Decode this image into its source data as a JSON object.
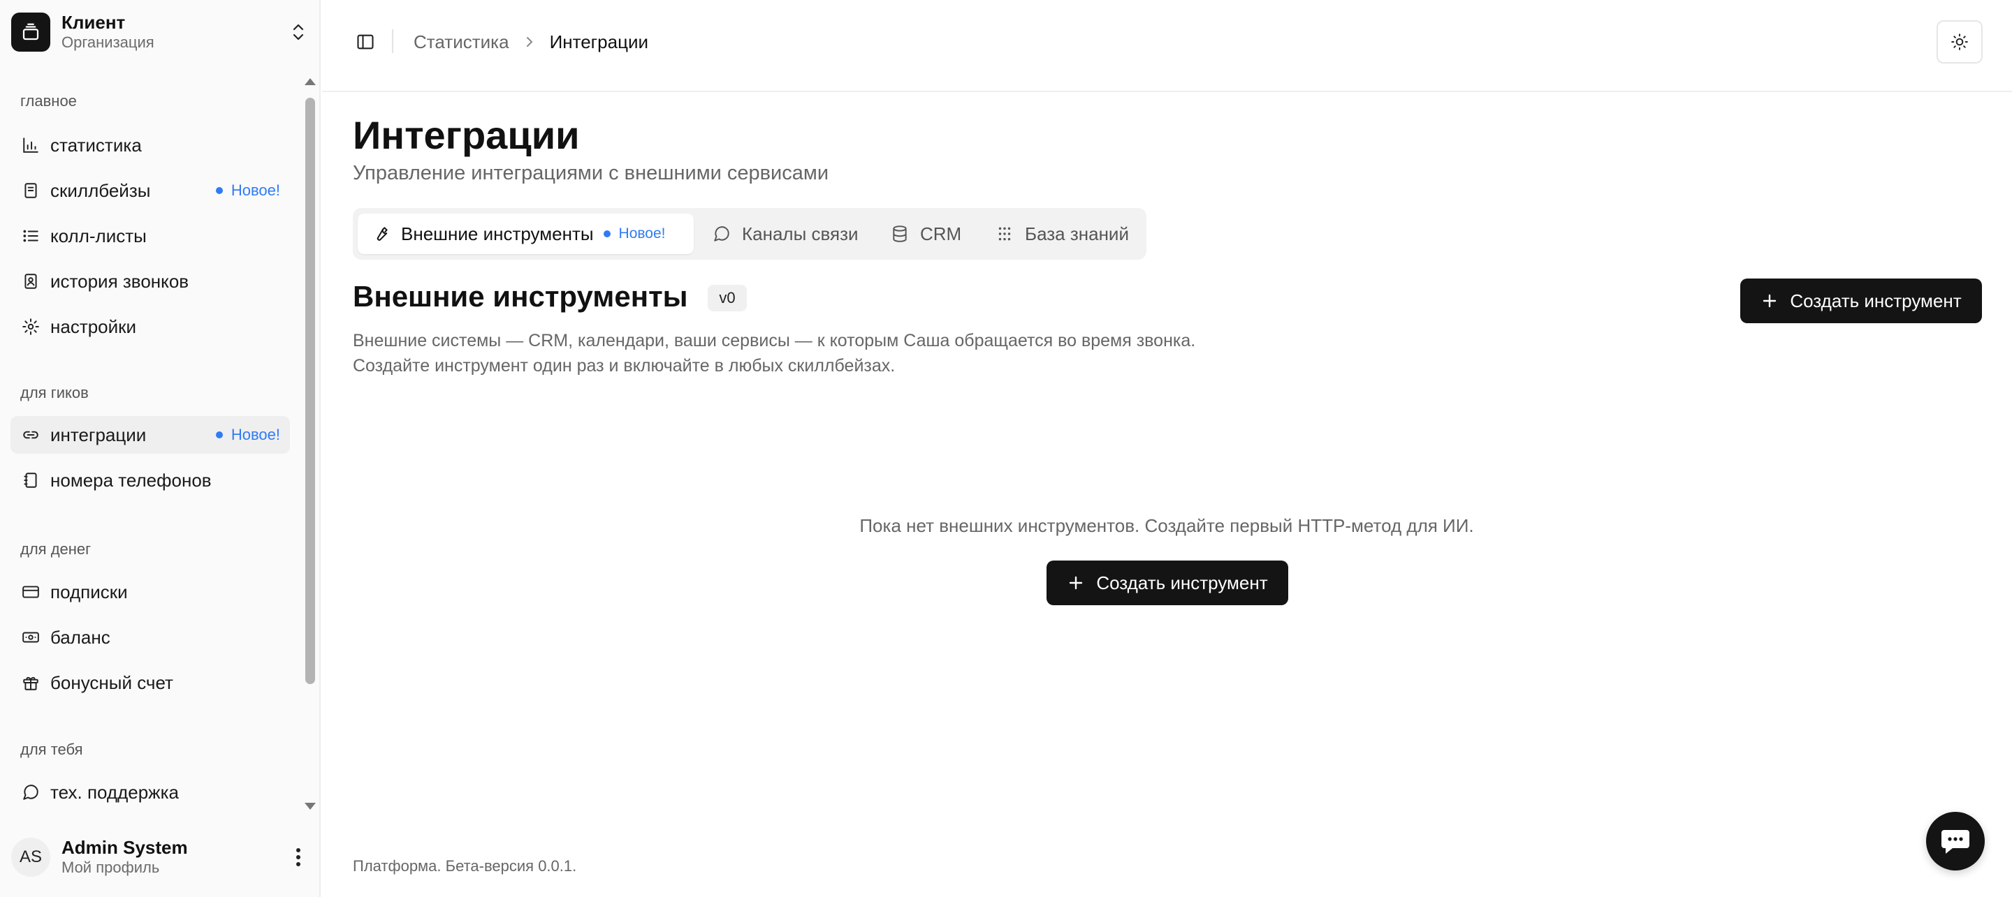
{
  "org": {
    "name": "Клиент",
    "subtitle": "Организация"
  },
  "sidebar": {
    "sections": [
      {
        "label": "главное"
      },
      {
        "label": "для гиков"
      },
      {
        "label": "для денег"
      },
      {
        "label": "для тебя"
      }
    ],
    "items": [
      {
        "label": "статистика",
        "icon": "bar-chart-icon"
      },
      {
        "label": "скиллбейзы",
        "icon": "notebook-icon",
        "badge": "Новое!"
      },
      {
        "label": "колл-листы",
        "icon": "list-icon"
      },
      {
        "label": "история звонков",
        "icon": "contact-book-icon"
      },
      {
        "label": "настройки",
        "icon": "gear-icon"
      },
      {
        "label": "интеграции",
        "icon": "link-icon",
        "badge": "Новое!",
        "active": true
      },
      {
        "label": "номера телефонов",
        "icon": "phone-book-icon"
      },
      {
        "label": "подписки",
        "icon": "credit-card-icon"
      },
      {
        "label": "баланс",
        "icon": "banknote-icon"
      },
      {
        "label": "бонусный счет",
        "icon": "gift-icon"
      },
      {
        "label": "тех. поддержка",
        "icon": "chat-bubble-icon"
      }
    ]
  },
  "user": {
    "initials": "AS",
    "name": "Admin System",
    "subtitle": "Мой профиль"
  },
  "breadcrumb": {
    "parent": "Статистика",
    "current": "Интеграции"
  },
  "page": {
    "title": "Интеграции",
    "subtitle": "Управление интеграциями с внешними сервисами"
  },
  "tabs": [
    {
      "label": "Внешние инструменты",
      "badge": "Новое!",
      "icon": "wrench-icon",
      "active": true
    },
    {
      "label": "Каналы связи",
      "icon": "chat-bubble-icon"
    },
    {
      "label": "CRM",
      "icon": "database-icon"
    },
    {
      "label": "База знаний",
      "icon": "grid-dots-icon"
    }
  ],
  "section": {
    "title": "Внешние инструменты",
    "version": "v0",
    "description_line1": "Внешние системы — CRM, календари, ваши сервисы — к которым Саша обращается во время звонка.",
    "description_line2": "Создайте инструмент один раз и включайте в любых скиллбейзах.",
    "create_button": "Создать инструмент"
  },
  "empty_state": {
    "text": "Пока нет внешних инструментов. Создайте первый HTTP-метод для ИИ.",
    "button": "Создать инструмент"
  },
  "footer": {
    "text": "Платформа. Бета-версия 0.0.1."
  },
  "colors": {
    "accent_badge": "#2f7bf5",
    "dark_button": "#141414"
  }
}
